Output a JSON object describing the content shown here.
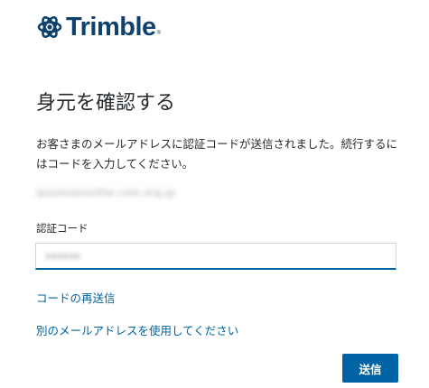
{
  "brand": {
    "name": "Trimble",
    "registered_mark": "®",
    "logo_icon": "trimble-globe-icon",
    "color": "#0e416c"
  },
  "page": {
    "title": "身元を確認する",
    "instructions": "お客さまのメールアドレスに認証コードが送信されました。続行するにはコードを入力してください。",
    "masked_email": "ipsoloseresthe.com.org.jp"
  },
  "form": {
    "code_label": "認証コード",
    "code_value": "xxxxxx",
    "accent_color": "#0063a3"
  },
  "links": {
    "resend_code": "コードの再送信",
    "use_other_email": "別のメールアドレスを使用してください"
  },
  "actions": {
    "submit_label": "送信"
  }
}
